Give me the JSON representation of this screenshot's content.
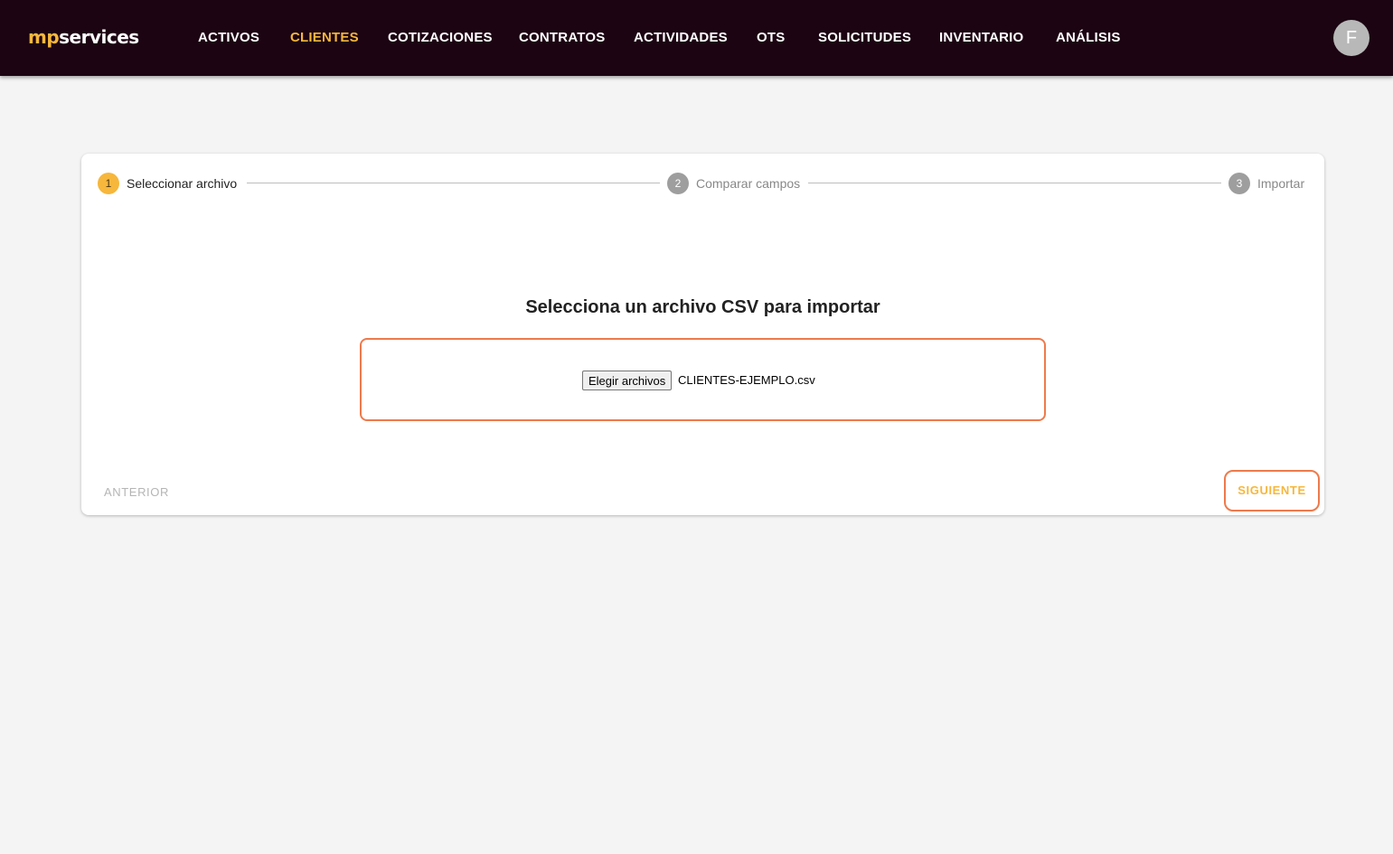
{
  "header": {
    "logo_prefix": "mp",
    "logo_suffix": "services",
    "nav": [
      {
        "label": "ACTIVOS"
      },
      {
        "label": "CLIENTES"
      },
      {
        "label": "COTIZACIONES"
      },
      {
        "label": "CONTRATOS"
      },
      {
        "label": "ACTIVIDADES"
      },
      {
        "label": "OTS"
      },
      {
        "label": "SOLICITUDES"
      },
      {
        "label": "INVENTARIO"
      },
      {
        "label": "ANÁLISIS"
      }
    ],
    "active_nav": "CLIENTES",
    "avatar_initial": "F"
  },
  "stepper": {
    "steps": [
      {
        "number": "1",
        "label": "Seleccionar archivo",
        "state": "active"
      },
      {
        "number": "2",
        "label": "Comparar campos",
        "state": "inactive"
      },
      {
        "number": "3",
        "label": "Importar",
        "state": "inactive"
      }
    ]
  },
  "upload": {
    "heading": "Selecciona un archivo CSV para importar",
    "choose_button": "Elegir archivos",
    "file_name": "CLIENTES-EJEMPLO.csv"
  },
  "footer": {
    "prev_label": "ANTERIOR",
    "next_label": "SIGUIENTE"
  },
  "colors": {
    "topbar": "#1c0412",
    "accent": "#f6b73c",
    "border_accent": "#ee7a4c",
    "background": "#f4f4f4"
  }
}
